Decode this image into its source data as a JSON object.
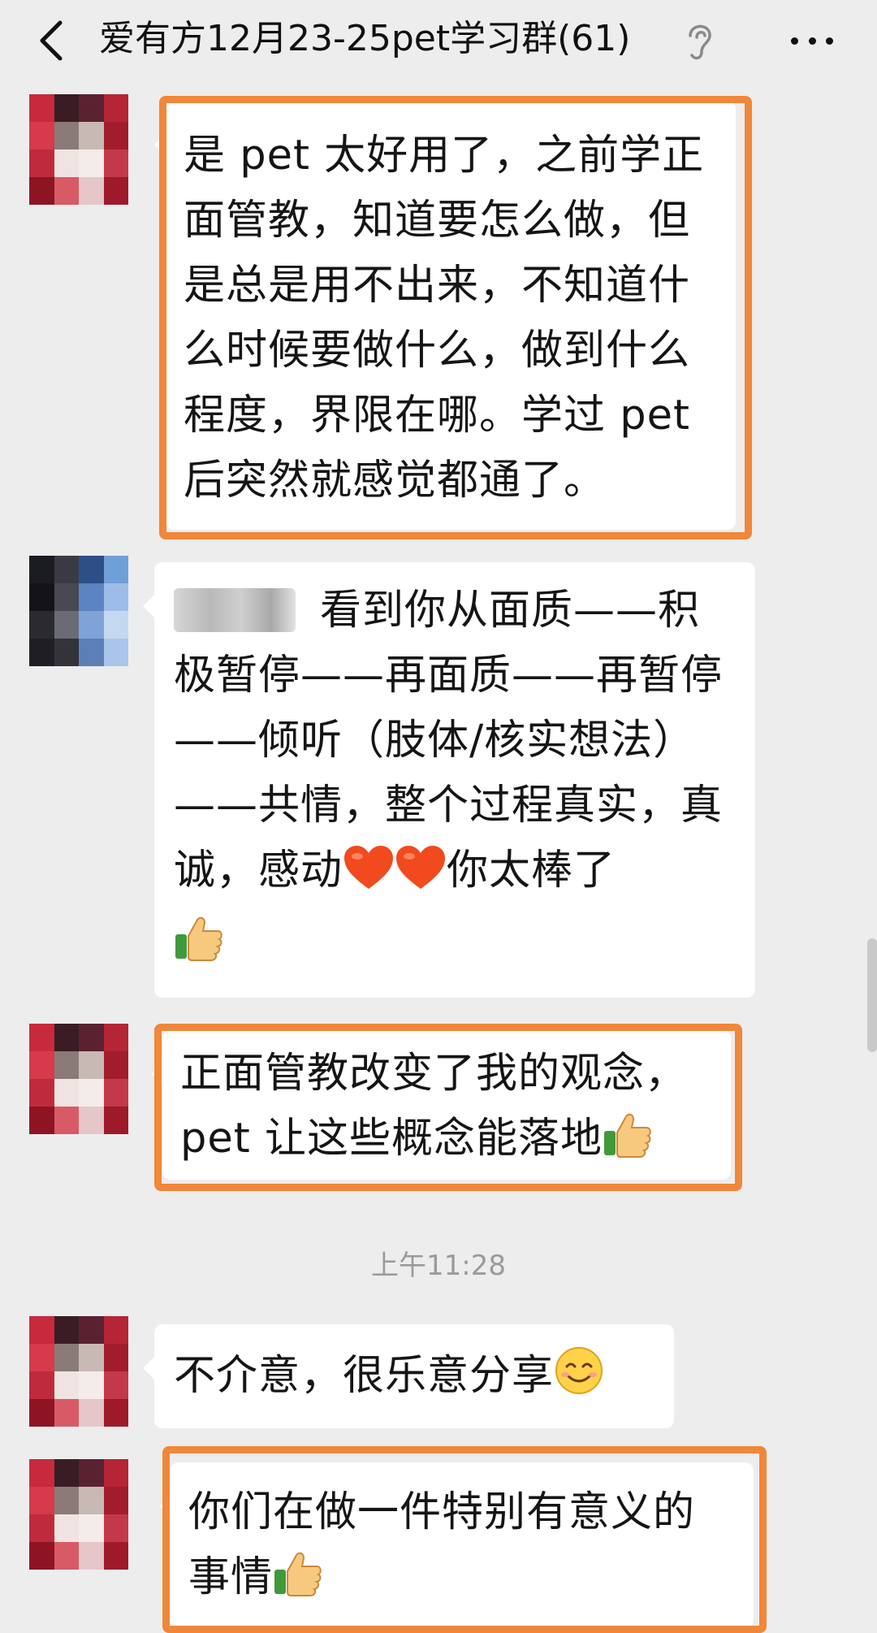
{
  "header": {
    "title": "爱有方12月23-25pet学习群(61)",
    "back_icon": "chevron-left-icon",
    "ear_icon": "ear-icon",
    "more_icon": "more-dots-icon"
  },
  "messages": [
    {
      "text": "是 pet 太好用了，之前学正面管教，知道要怎么做，但是总是用不出来，不知道什么时候要做什么，做到什么程度，界限在哪。学过 pet 后突然就感觉都通了。"
    },
    {
      "text": "看到你从面质——积极暂停——再面质——再暂停——倾听（肢体/核实想法）——共情，整个过程真实，真诚，感动",
      "text_after": "你太棒了"
    },
    {
      "text": "正面管教改变了我的观念，pet 让这些概念能落地"
    },
    {
      "text": "不介意，很乐意分享"
    },
    {
      "text": "你们在做一件特别有意义的事情"
    }
  ],
  "timestamp": "上午11:28",
  "colors": {
    "background": "#ededed",
    "bubble": "#ffffff",
    "highlight_border": "#f0873a",
    "heart": "#f04a1e",
    "thumb": "#f7c97e"
  }
}
